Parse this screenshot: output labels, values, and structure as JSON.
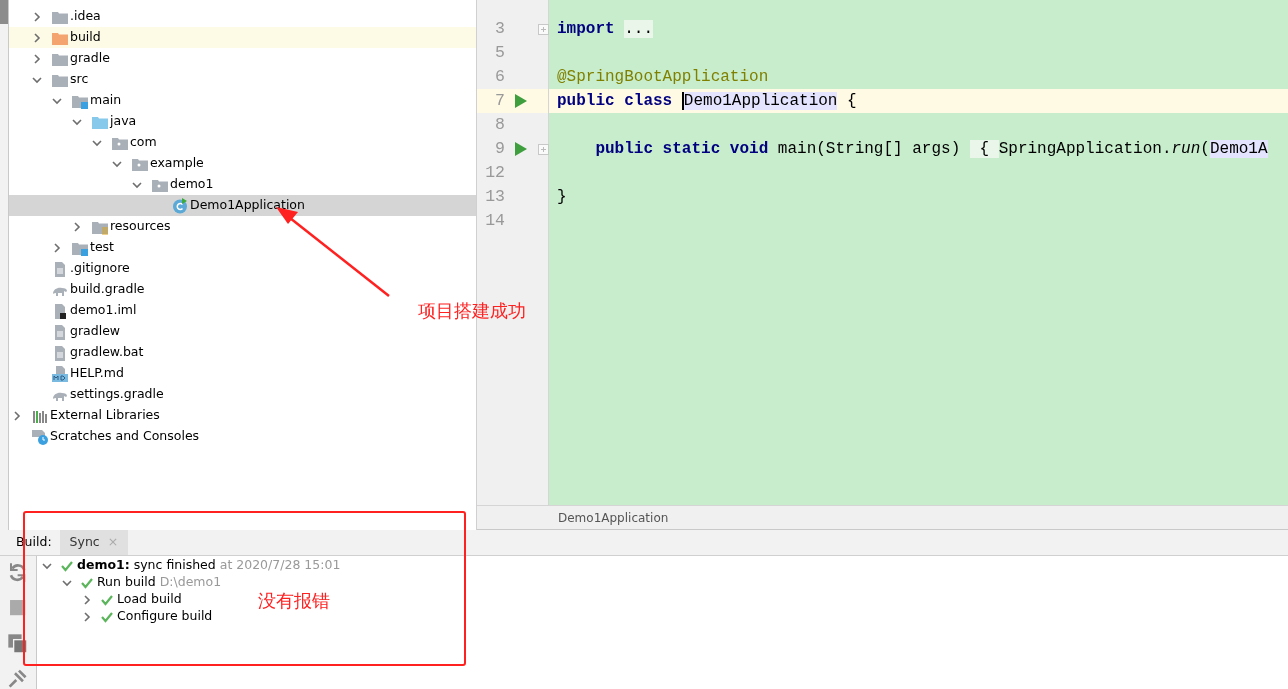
{
  "project_tree": {
    "items": [
      {
        "label": ".idea",
        "kind": "folder",
        "expanded": false,
        "selected": false
      },
      {
        "label": "build",
        "kind": "excluded-folder",
        "expanded": false,
        "selected": false
      },
      {
        "label": "gradle",
        "kind": "folder",
        "expanded": false,
        "selected": false
      },
      {
        "label": "src",
        "kind": "folder",
        "expanded": true,
        "selected": false,
        "children": [
          {
            "label": "main",
            "kind": "source-set",
            "expanded": true,
            "selected": false,
            "children": [
              {
                "label": "java",
                "kind": "source-root",
                "expanded": true,
                "selected": false,
                "children": [
                  {
                    "label": "com",
                    "kind": "package",
                    "expanded": true,
                    "selected": false,
                    "children": [
                      {
                        "label": "example",
                        "kind": "package",
                        "expanded": true,
                        "selected": false,
                        "children": [
                          {
                            "label": "demo1",
                            "kind": "package",
                            "expanded": true,
                            "selected": false,
                            "children": [
                              {
                                "label": "Demo1Application",
                                "kind": "class",
                                "selected": true
                              }
                            ]
                          }
                        ]
                      }
                    ]
                  }
                ]
              },
              {
                "label": "resources",
                "kind": "resource-root",
                "expanded": false,
                "selected": false
              }
            ]
          },
          {
            "label": "test",
            "kind": "source-set",
            "expanded": false,
            "selected": false
          }
        ]
      },
      {
        "label": ".gitignore",
        "kind": "text-file",
        "selected": false
      },
      {
        "label": "build.gradle",
        "kind": "gradle-file",
        "selected": false
      },
      {
        "label": "demo1.iml",
        "kind": "iml-file",
        "selected": false
      },
      {
        "label": "gradlew",
        "kind": "text-file",
        "selected": false
      },
      {
        "label": "gradlew.bat",
        "kind": "text-file",
        "selected": false
      },
      {
        "label": "HELP.md",
        "kind": "markdown-file",
        "selected": false
      },
      {
        "label": "settings.gradle",
        "kind": "gradle-file",
        "selected": false
      }
    ],
    "root_items": [
      {
        "label": "External Libraries",
        "kind": "libraries",
        "expanded": false,
        "selected": false
      },
      {
        "label": "Scratches and Consoles",
        "kind": "scratches",
        "selected": false
      }
    ]
  },
  "editor": {
    "lines": [
      {
        "number": "3",
        "run": false,
        "fold": true,
        "current": false,
        "tokens": [
          {
            "text": "import ",
            "kind": "keyword"
          },
          {
            "text": "...",
            "kind": "folded"
          }
        ]
      },
      {
        "number": "5",
        "run": false,
        "fold": false,
        "current": false
      },
      {
        "number": "6",
        "run": false,
        "fold": false,
        "current": false,
        "tokens": [
          {
            "text": "@SpringBootApplication",
            "kind": "annotation"
          }
        ]
      },
      {
        "number": "7",
        "run": true,
        "fold": false,
        "current": true,
        "tokens": [
          {
            "text": "public class ",
            "kind": "keyword"
          },
          {
            "text": "Demo1Application",
            "kind": "ref-caret"
          },
          {
            "text": " {",
            "kind": "plain"
          }
        ]
      },
      {
        "number": "8",
        "run": false,
        "fold": false,
        "current": false
      },
      {
        "number": "9",
        "run": true,
        "fold": true,
        "current": false,
        "tokens": [
          {
            "text": "    public static void ",
            "kind": "keyword"
          },
          {
            "text": "main(String[] args) ",
            "kind": "plain"
          },
          {
            "text": " { ",
            "kind": "folded"
          },
          {
            "text": "SpringApplication.",
            "kind": "plain"
          },
          {
            "text": "run",
            "kind": "static-call"
          },
          {
            "text": "(",
            "kind": "plain"
          },
          {
            "text": "Demo1A",
            "kind": "ref"
          }
        ]
      },
      {
        "number": "12",
        "run": false,
        "fold": false,
        "current": false
      },
      {
        "number": "13",
        "run": false,
        "fold": false,
        "current": false,
        "tokens": [
          {
            "text": "}",
            "kind": "plain"
          }
        ]
      },
      {
        "number": "14",
        "run": false,
        "fold": false,
        "current": false
      }
    ],
    "breadcrumb": "Demo1Application"
  },
  "build_panel": {
    "label": "Build:",
    "tabs": [
      {
        "label": "Sync",
        "selected": true,
        "close": "×"
      }
    ],
    "tree": [
      {
        "text": "**demo1:** sync finished",
        "detail": "at 2020/7/28 15:01",
        "expanded": true,
        "children": [
          {
            "text": "Run build",
            "detail": "D:\\demo1",
            "expanded": true,
            "children": [
              {
                "text": "Load build",
                "expanded": false
              },
              {
                "text": "Configure build",
                "expanded": false
              }
            ]
          }
        ]
      }
    ]
  },
  "annotations": [
    {
      "kind": "arrow-note",
      "text": "项目搭建成功"
    },
    {
      "kind": "box-note",
      "text": "没有报错"
    }
  ]
}
